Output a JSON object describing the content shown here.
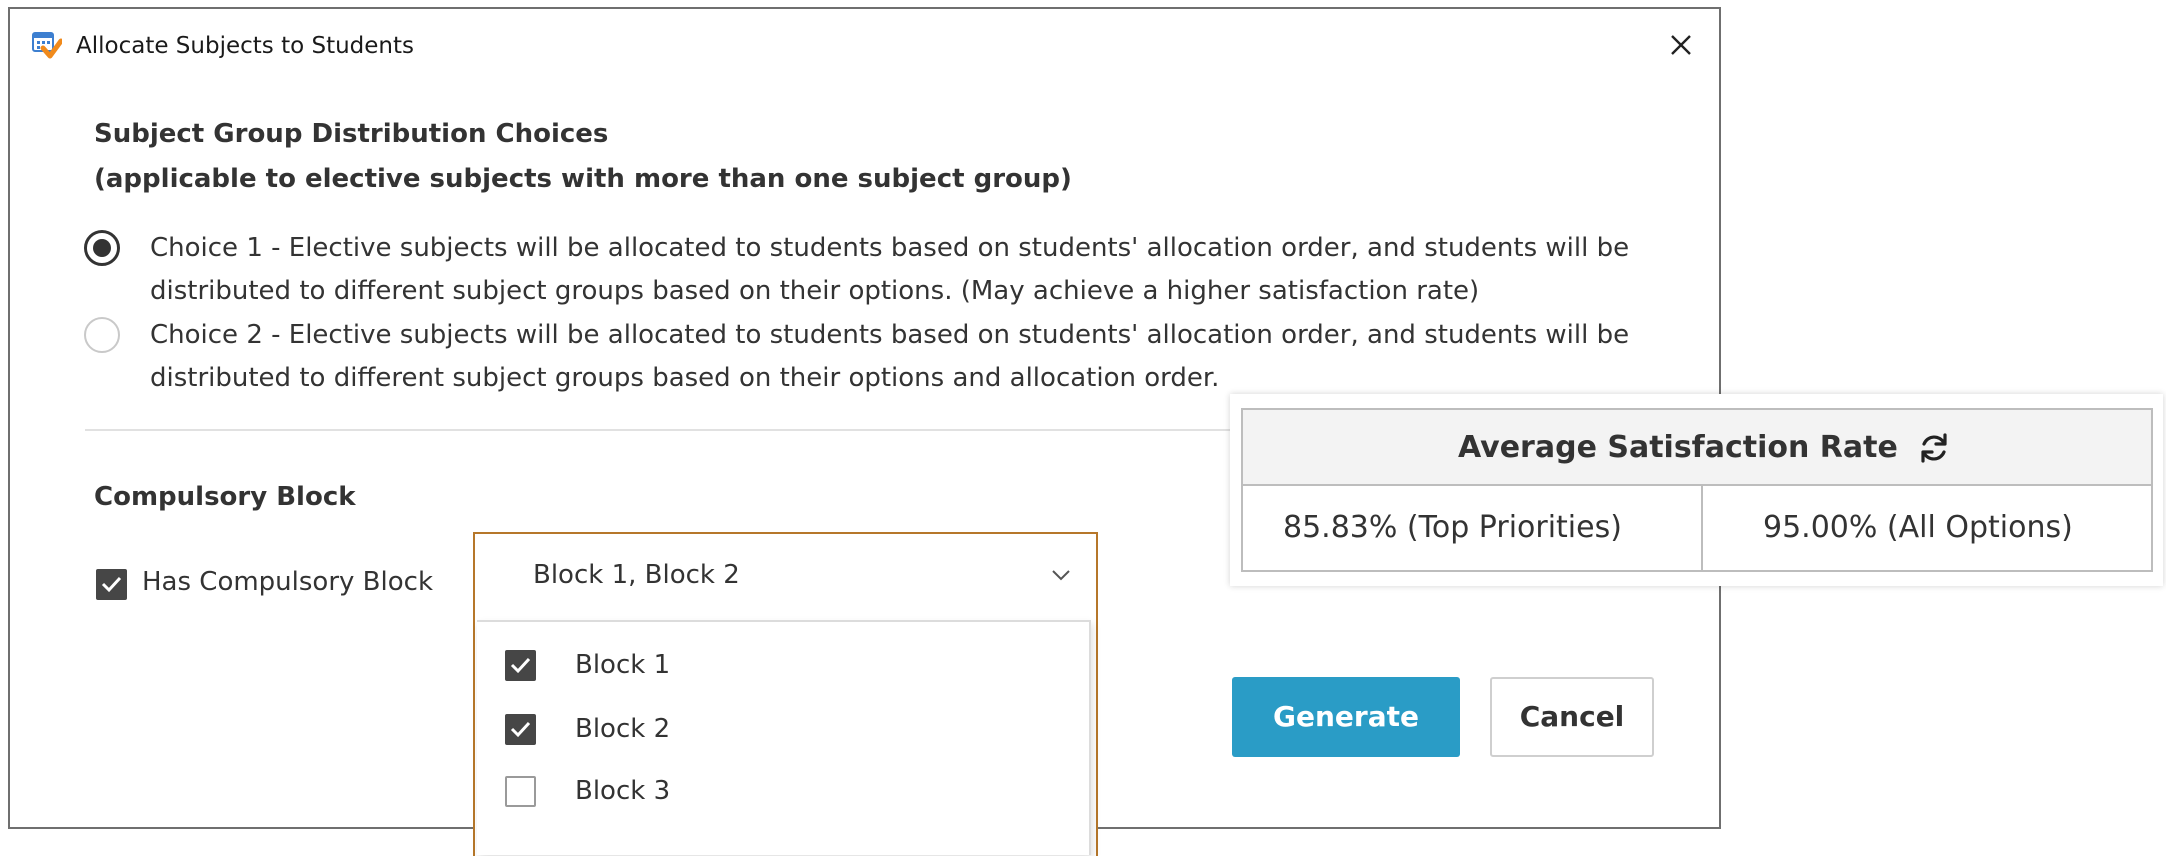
{
  "window": {
    "title": "Allocate Subjects to Students",
    "app_icon": "calendar-check-icon",
    "close_icon": "close-icon"
  },
  "distribution": {
    "heading": "Subject Group Distribution Choices",
    "subheading": "(applicable to elective subjects with more than one subject group)",
    "choices": [
      {
        "label": "Choice 1 - Elective subjects will be allocated to students based on students' allocation order, and students will be distributed to different subject groups based on their options. (May achieve a higher satisfaction rate)",
        "selected": true
      },
      {
        "label": "Choice 2 - Elective subjects will be allocated to students based on students' allocation order, and students will be distributed to different subject groups based on their options and allocation order.",
        "selected": false
      }
    ]
  },
  "compulsory": {
    "heading": "Compulsory Block",
    "has_block_label": "Has Compulsory Block",
    "has_block_checked": true,
    "dropdown_value": "Block 1, Block 2",
    "options": [
      {
        "label": "Block 1",
        "checked": true
      },
      {
        "label": "Block 2",
        "checked": true
      },
      {
        "label": "Block 3",
        "checked": false
      }
    ]
  },
  "buttons": {
    "generate": "Generate",
    "cancel": "Cancel"
  },
  "satisfaction": {
    "title": "Average Satisfaction Rate",
    "refresh_icon": "refresh-icon",
    "top_priorities": "85.83% (Top Priorities)",
    "all_options": "95.00% (All Options)"
  },
  "colors": {
    "primary_button": "#2a9cc6",
    "dropdown_focus_border": "#b6772a",
    "checkbox_fill": "#464646"
  }
}
